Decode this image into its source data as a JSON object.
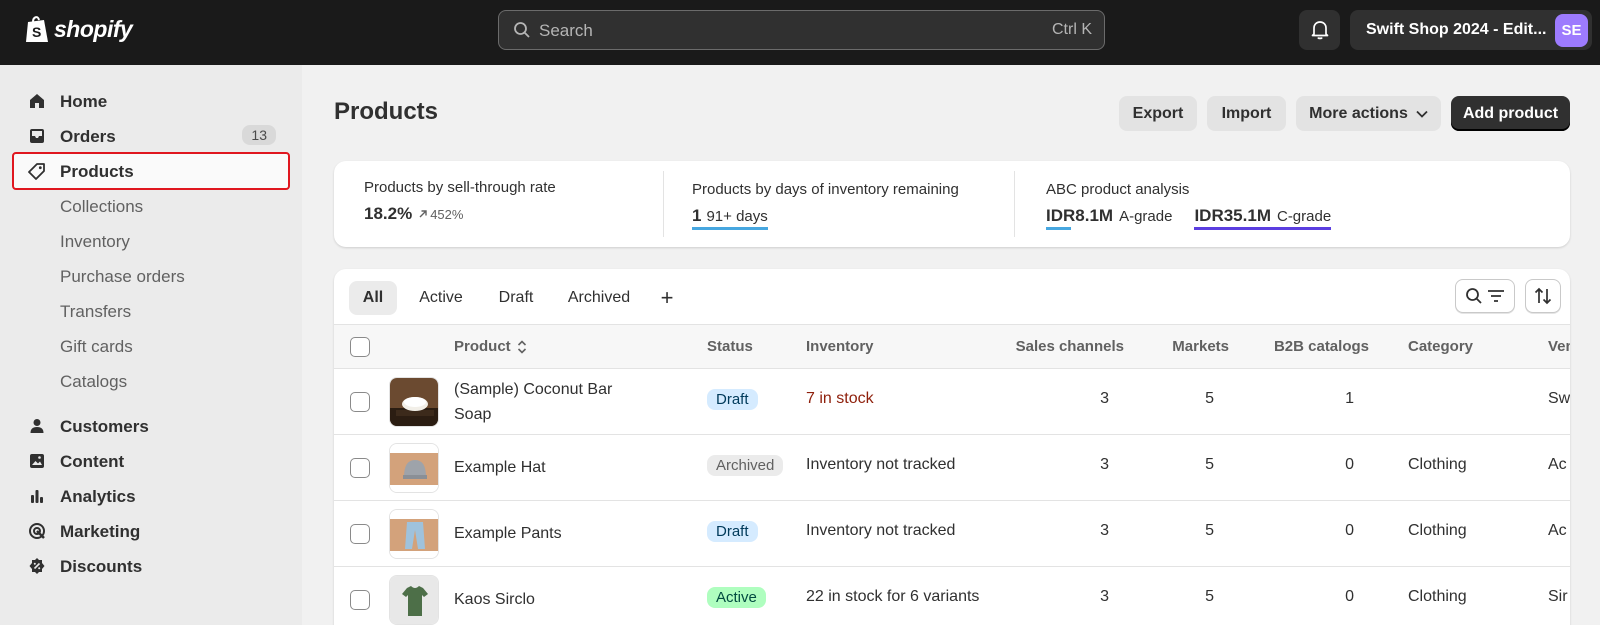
{
  "topbar": {
    "logo_text": "shopify",
    "search_placeholder": "Search",
    "search_shortcut": "Ctrl K",
    "store_name": "Swift Shop 2024 - Edit...",
    "avatar_initials": "SE"
  },
  "sidebar": {
    "items": [
      {
        "label": "Home",
        "icon": "home-icon"
      },
      {
        "label": "Orders",
        "icon": "inbox-icon",
        "badge": "13"
      },
      {
        "label": "Products",
        "icon": "tag-icon",
        "active": true
      },
      {
        "label": "Collections"
      },
      {
        "label": "Inventory"
      },
      {
        "label": "Purchase orders"
      },
      {
        "label": "Transfers"
      },
      {
        "label": "Gift cards"
      },
      {
        "label": "Catalogs"
      },
      {
        "label": "Customers",
        "icon": "person-icon"
      },
      {
        "label": "Content",
        "icon": "image-icon"
      },
      {
        "label": "Analytics",
        "icon": "bar-chart-icon"
      },
      {
        "label": "Marketing",
        "icon": "target-icon"
      },
      {
        "label": "Discounts",
        "icon": "discount-icon"
      }
    ]
  },
  "page": {
    "title": "Products",
    "actions": {
      "export": "Export",
      "import": "Import",
      "more": "More actions",
      "add": "Add product"
    }
  },
  "analytics": {
    "sell_through": {
      "title": "Products by sell-through rate",
      "value": "18.2%",
      "change": "452%"
    },
    "days_inventory": {
      "title": "Products by days of inventory remaining",
      "value": "1",
      "suffix": "91+ days"
    },
    "abc": {
      "title": "ABC product analysis",
      "a_value": "IDR8.1M",
      "a_label": "A-grade",
      "c_value": "IDR35.1M",
      "c_label": "C-grade"
    },
    "colors": {
      "blue": "#47a7e0",
      "purple": "#5b3ee0"
    }
  },
  "tabs": [
    "All",
    "Active",
    "Draft",
    "Archived",
    "+"
  ],
  "table": {
    "headers": {
      "product": "Product",
      "status": "Status",
      "inventory": "Inventory",
      "sales_channels": "Sales channels",
      "markets": "Markets",
      "b2b": "B2B catalogs",
      "category": "Category",
      "vendor": "Ven"
    },
    "rows": [
      {
        "name_line1": "(Sample) Coconut Bar",
        "name_line2": "Soap",
        "status": "Draft",
        "inventory": "7 in stock",
        "sales_channels": "3",
        "markets": "5",
        "b2b": "1",
        "category": "",
        "vendor": "Sw"
      },
      {
        "name": "Example Hat",
        "status": "Archived",
        "inventory": "Inventory not tracked",
        "sales_channels": "3",
        "markets": "5",
        "b2b": "0",
        "category": "Clothing",
        "vendor": "Ac"
      },
      {
        "name": "Example Pants",
        "status": "Draft",
        "inventory": "Inventory not tracked",
        "sales_channels": "3",
        "markets": "5",
        "b2b": "0",
        "category": "Clothing",
        "vendor": "Ac"
      },
      {
        "name": "Kaos Sirclo",
        "status": "Active",
        "inventory": "22 in stock for 6 variants",
        "sales_channels": "3",
        "markets": "5",
        "b2b": "0",
        "category": "Clothing",
        "vendor": "Sir"
      }
    ]
  }
}
